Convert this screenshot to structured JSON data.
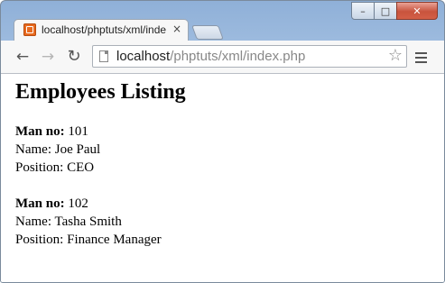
{
  "tab": {
    "title": "localhost/phptuts/xml/index",
    "close_glyph": "×",
    "favicon": "xampp-icon"
  },
  "window_controls": {
    "minimize": "–",
    "maximize": "□",
    "close": "✕"
  },
  "toolbar": {
    "back": "←",
    "forward": "→",
    "reload": "↻",
    "url_host": "localhost",
    "url_path": "/phptuts/xml/index.php",
    "star": "☆"
  },
  "page": {
    "heading": "Employees Listing",
    "labels": {
      "man_no": "Man no:",
      "name": "Name:",
      "position": "Position:"
    },
    "employees": [
      {
        "man_no": "101",
        "name": "Joe Paul",
        "position": "CEO"
      },
      {
        "man_no": "102",
        "name": "Tasha Smith",
        "position": "Finance Manager"
      }
    ]
  },
  "colors": {
    "frame": "#b5cde9",
    "close_button": "#c8533d",
    "favicon": "#e86a1f"
  }
}
